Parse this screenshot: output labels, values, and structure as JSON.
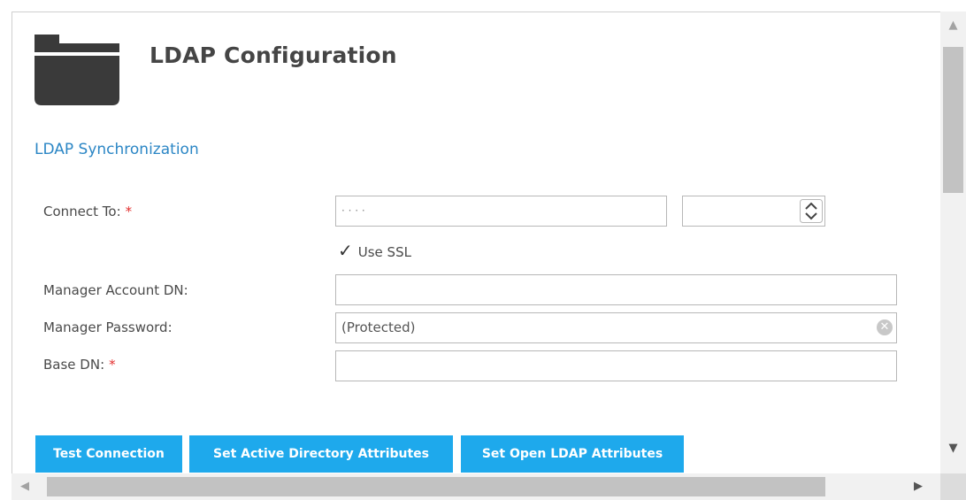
{
  "header": {
    "title": "LDAP Configuration",
    "icon": "folder-icon"
  },
  "section": {
    "title": "LDAP Synchronization"
  },
  "form": {
    "connect_to": {
      "label": "Connect To:",
      "required_mark": "*",
      "host_value": "·  ·  ·  ·",
      "port_value": ""
    },
    "use_ssl": {
      "label": "Use SSL",
      "checked": true,
      "check_glyph": "✓"
    },
    "manager_dn": {
      "label": "Manager Account DN:",
      "value": ""
    },
    "manager_password": {
      "label": "Manager Password:",
      "value": "(Protected)"
    },
    "base_dn": {
      "label": "Base DN:",
      "required_mark": "*",
      "value": ""
    }
  },
  "buttons": {
    "test": "Test Connection",
    "active_directory": "Set Active Directory Attributes",
    "open_ldap": "Set Open LDAP Attributes"
  },
  "colors": {
    "accent": "#1ea9ec",
    "section_link": "#2b86c5",
    "required": "#e3302f"
  }
}
